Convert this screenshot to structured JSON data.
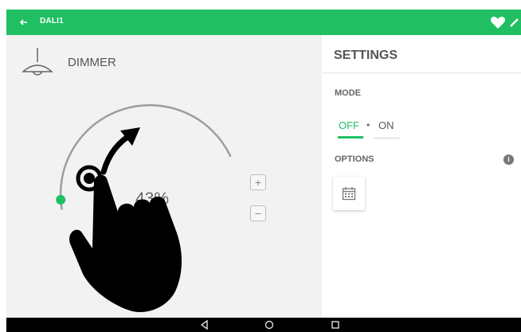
{
  "appbar": {
    "title": "DALI1",
    "back_icon": "arrow-left-icon",
    "favorite_icon": "heart-icon",
    "edit_icon": "pencil-icon"
  },
  "device": {
    "label": "DIMMER",
    "icon": "ceiling-lamp-icon"
  },
  "dimmer": {
    "value_text": "43%",
    "level_percent": 43,
    "increase_label": "+",
    "decrease_label": "−"
  },
  "settings": {
    "title": "SETTINGS",
    "mode_label": "MODE",
    "mode_options": [
      "OFF",
      "ON"
    ],
    "mode_separator": "•",
    "selected_mode": "OFF",
    "options_label": "OPTIONS",
    "info_label": "i",
    "schedule_icon": "calendar-icon"
  },
  "navbar": {
    "icons": [
      "back-triangle-icon",
      "home-circle-icon",
      "recents-square-icon"
    ]
  },
  "colors": {
    "accent": "#1fbf62",
    "navbar": "#000000",
    "panel": "#f2f2f2"
  }
}
